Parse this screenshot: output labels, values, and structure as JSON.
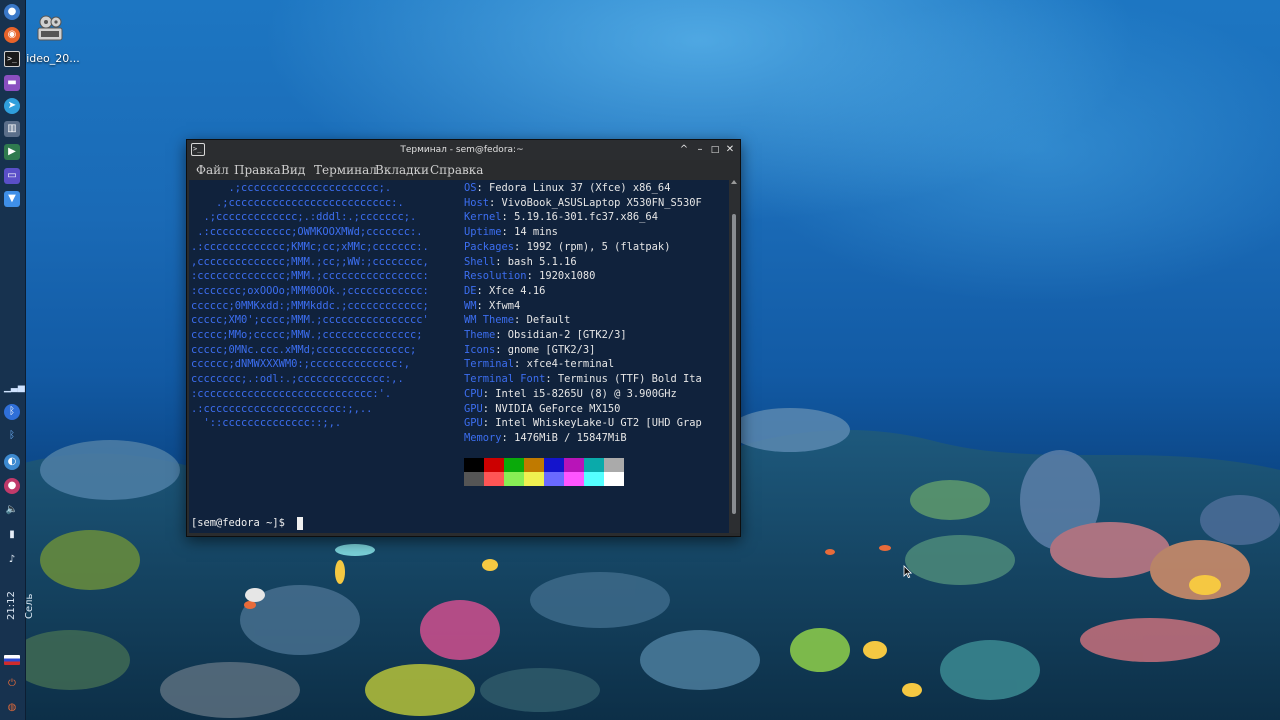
{
  "desktop": {
    "icon_label": "ideo_20...",
    "clock": {
      "time": "21:12",
      "day": "Сель"
    }
  },
  "terminal": {
    "title": "Терминал - sem@fedora:~",
    "menu": [
      "Файл",
      "Правка",
      "Вид",
      "Терминал",
      "Вкладки",
      "Справка"
    ],
    "logo_lines": [
      "      .;cccccccccccccccccccccc;.",
      "    .;cccccccccccccccccccccccccc:.",
      "  .;ccccccccccccc;.:dddl:.;ccccccc;.",
      " .:ccccccccccccc;OWMKOOXMWd;ccccccc:.",
      ".:ccccccccccccc;KMMc;cc;xMMc;ccccccc:.",
      ",cccccccccccccc;MMM.;cc;;WW:;cccccccc,",
      ":cccccccccccccc;MMM.;cccccccccccccccc:",
      ":ccccccc;oxOOOo;MMM0OOk.;cccccccccccc:",
      "cccccc;0MMKxdd:;MMMkddc.;cccccccccccc;",
      "ccccc;XM0';cccc;MMM.;cccccccccccccccc'",
      "ccccc;MMo;ccccc;MMW.;ccccccccccccccc;",
      "ccccc;0MNc.ccc.xMMd;ccccccccccccccc;",
      "cccccc;dNMWXXXWM0:;cccccccccccccc:,",
      "cccccccc;.:odl:.;cccccccccccccc:,.",
      ":cccccccccccccccccccccccccccc:'.",
      ".:cccccccccccccccccccccc:;,..",
      "  '::cccccccccccccc::;,."
    ],
    "info": [
      {
        "key": "OS",
        "value": "Fedora Linux 37 (Xfce) x86_64"
      },
      {
        "key": "Host",
        "value": "VivoBook_ASUSLaptop X530FN_S530F"
      },
      {
        "key": "Kernel",
        "value": "5.19.16-301.fc37.x86_64"
      },
      {
        "key": "Uptime",
        "value": "14 mins"
      },
      {
        "key": "Packages",
        "value": "1992 (rpm), 5 (flatpak)"
      },
      {
        "key": "Shell",
        "value": "bash 5.1.16"
      },
      {
        "key": "Resolution",
        "value": "1920x1080"
      },
      {
        "key": "DE",
        "value": "Xfce 4.16"
      },
      {
        "key": "WM",
        "value": "Xfwm4"
      },
      {
        "key": "WM Theme",
        "value": "Default"
      },
      {
        "key": "Theme",
        "value": "Obsidian-2 [GTK2/3]"
      },
      {
        "key": "Icons",
        "value": "gnome [GTK2/3]"
      },
      {
        "key": "Terminal",
        "value": "xfce4-terminal"
      },
      {
        "key": "Terminal Font",
        "value": "Terminus (TTF) Bold Ita"
      },
      {
        "key": "CPU",
        "value": "Intel i5-8265U (8) @ 3.900GHz"
      },
      {
        "key": "GPU",
        "value": "NVIDIA GeForce MX150"
      },
      {
        "key": "GPU",
        "value": "Intel WhiskeyLake-U GT2 [UHD Grap"
      },
      {
        "key": "Memory",
        "value": "1476MiB / 15847MiB"
      }
    ],
    "palette_normal": [
      "#000000",
      "#cc0000",
      "#0aaa0a",
      "#c07a00",
      "#1414cc",
      "#b814b8",
      "#0aaaaa",
      "#aaaaaa"
    ],
    "palette_bright": [
      "#555555",
      "#ff5555",
      "#88ee55",
      "#f0f050",
      "#6a6aff",
      "#ff55ff",
      "#55ffff",
      "#ffffff"
    ],
    "prompt": "[sem@fedora ~]$ "
  }
}
